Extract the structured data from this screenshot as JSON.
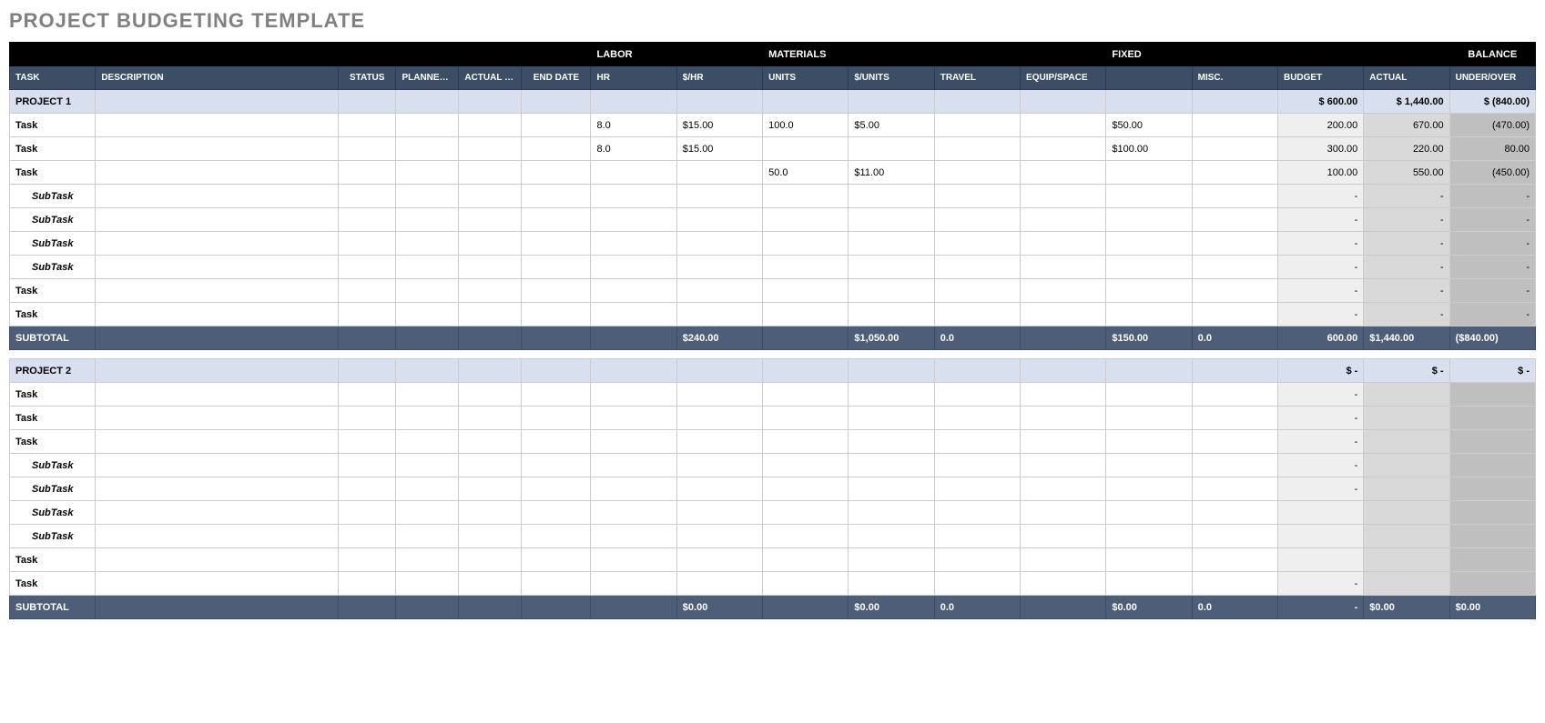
{
  "title": "PROJECT BUDGETING TEMPLATE",
  "groupHeaders": {
    "labor": "LABOR",
    "materials": "MATERIALS",
    "fixed": "FIXED",
    "balance": "BALANCE"
  },
  "columns": {
    "task": "TASK",
    "description": "DESCRIPTION",
    "status": "STATUS",
    "plannedStart": "PLANNED START DATE",
    "actualStart": "ACTUAL START DATE",
    "endDate": "END DATE",
    "hr": "HR",
    "rate": "$/HR",
    "units": "UNITS",
    "perUnits": "$/UNITS",
    "travel": "TRAVEL",
    "equip": "EQUIP/SPACE",
    "fixed": "",
    "misc": "MISC.",
    "budget": "BUDGET",
    "actual": "ACTUAL",
    "underOver": "UNDER/OVER"
  },
  "projects": [
    {
      "name": "PROJECT 1",
      "summary": {
        "budget": "$         600.00",
        "actual": "$      1,440.00",
        "underOver": "$        (840.00)"
      },
      "rows": [
        {
          "type": "task",
          "label": "Task",
          "hr": "8.0",
          "rate": "$15.00",
          "units": "100.0",
          "perUnits": "$5.00",
          "travel": "",
          "equip": "",
          "fixed": "$50.00",
          "misc": "",
          "budget": "200.00",
          "actual": "670.00",
          "underOver": "(470.00)"
        },
        {
          "type": "task",
          "label": "Task",
          "hr": "8.0",
          "rate": "$15.00",
          "units": "",
          "perUnits": "",
          "travel": "",
          "equip": "",
          "fixed": "$100.00",
          "misc": "",
          "budget": "300.00",
          "actual": "220.00",
          "underOver": "80.00"
        },
        {
          "type": "task",
          "label": "Task",
          "hr": "",
          "rate": "",
          "units": "50.0",
          "perUnits": "$11.00",
          "travel": "",
          "equip": "",
          "fixed": "",
          "misc": "",
          "budget": "100.00",
          "actual": "550.00",
          "underOver": "(450.00)"
        },
        {
          "type": "subtask",
          "label": "SubTask",
          "budget": "-",
          "actual": "-",
          "underOver": "-"
        },
        {
          "type": "subtask",
          "label": "SubTask",
          "budget": "-",
          "actual": "-",
          "underOver": "-"
        },
        {
          "type": "subtask",
          "label": "SubTask",
          "budget": "-",
          "actual": "-",
          "underOver": "-"
        },
        {
          "type": "subtask",
          "label": "SubTask",
          "budget": "-",
          "actual": "-",
          "underOver": "-"
        },
        {
          "type": "task",
          "label": "Task",
          "budget": "-",
          "actual": "-",
          "underOver": "-"
        },
        {
          "type": "task",
          "label": "Task",
          "budget": "-",
          "actual": "-",
          "underOver": "-"
        }
      ],
      "subtotal": {
        "label": "SUBTOTAL",
        "rate": "$240.00",
        "perUnits": "$1,050.00",
        "travel": "0.0",
        "fixed": "$150.00",
        "misc": "0.0",
        "budget": "600.00",
        "actual": "$1,440.00",
        "underOver": "($840.00)"
      }
    },
    {
      "name": "PROJECT 2",
      "summary": {
        "budget": "$                -",
        "actual": "$                -",
        "underOver": "$                -"
      },
      "rows": [
        {
          "type": "task",
          "label": "Task",
          "budget": "-",
          "actual": "",
          "underOver": ""
        },
        {
          "type": "task",
          "label": "Task",
          "budget": "-",
          "actual": "",
          "underOver": ""
        },
        {
          "type": "task",
          "label": "Task",
          "budget": "-",
          "actual": "",
          "underOver": ""
        },
        {
          "type": "subtask",
          "label": "SubTask",
          "budget": "-",
          "actual": "",
          "underOver": ""
        },
        {
          "type": "subtask",
          "label": "SubTask",
          "budget": "-",
          "actual": "",
          "underOver": ""
        },
        {
          "type": "subtask",
          "label": "SubTask",
          "budget": "",
          "actual": "",
          "underOver": ""
        },
        {
          "type": "subtask",
          "label": "SubTask",
          "budget": "",
          "actual": "",
          "underOver": ""
        },
        {
          "type": "task",
          "label": "Task",
          "budget": "",
          "actual": "",
          "underOver": ""
        },
        {
          "type": "task",
          "label": "Task",
          "budget": "-",
          "actual": "",
          "underOver": ""
        }
      ],
      "subtotal": {
        "label": "SUBTOTAL",
        "rate": "$0.00",
        "perUnits": "$0.00",
        "travel": "0.0",
        "fixed": "$0.00",
        "misc": "0.0",
        "budget": "-",
        "actual": "$0.00",
        "underOver": "$0.00"
      }
    }
  ]
}
